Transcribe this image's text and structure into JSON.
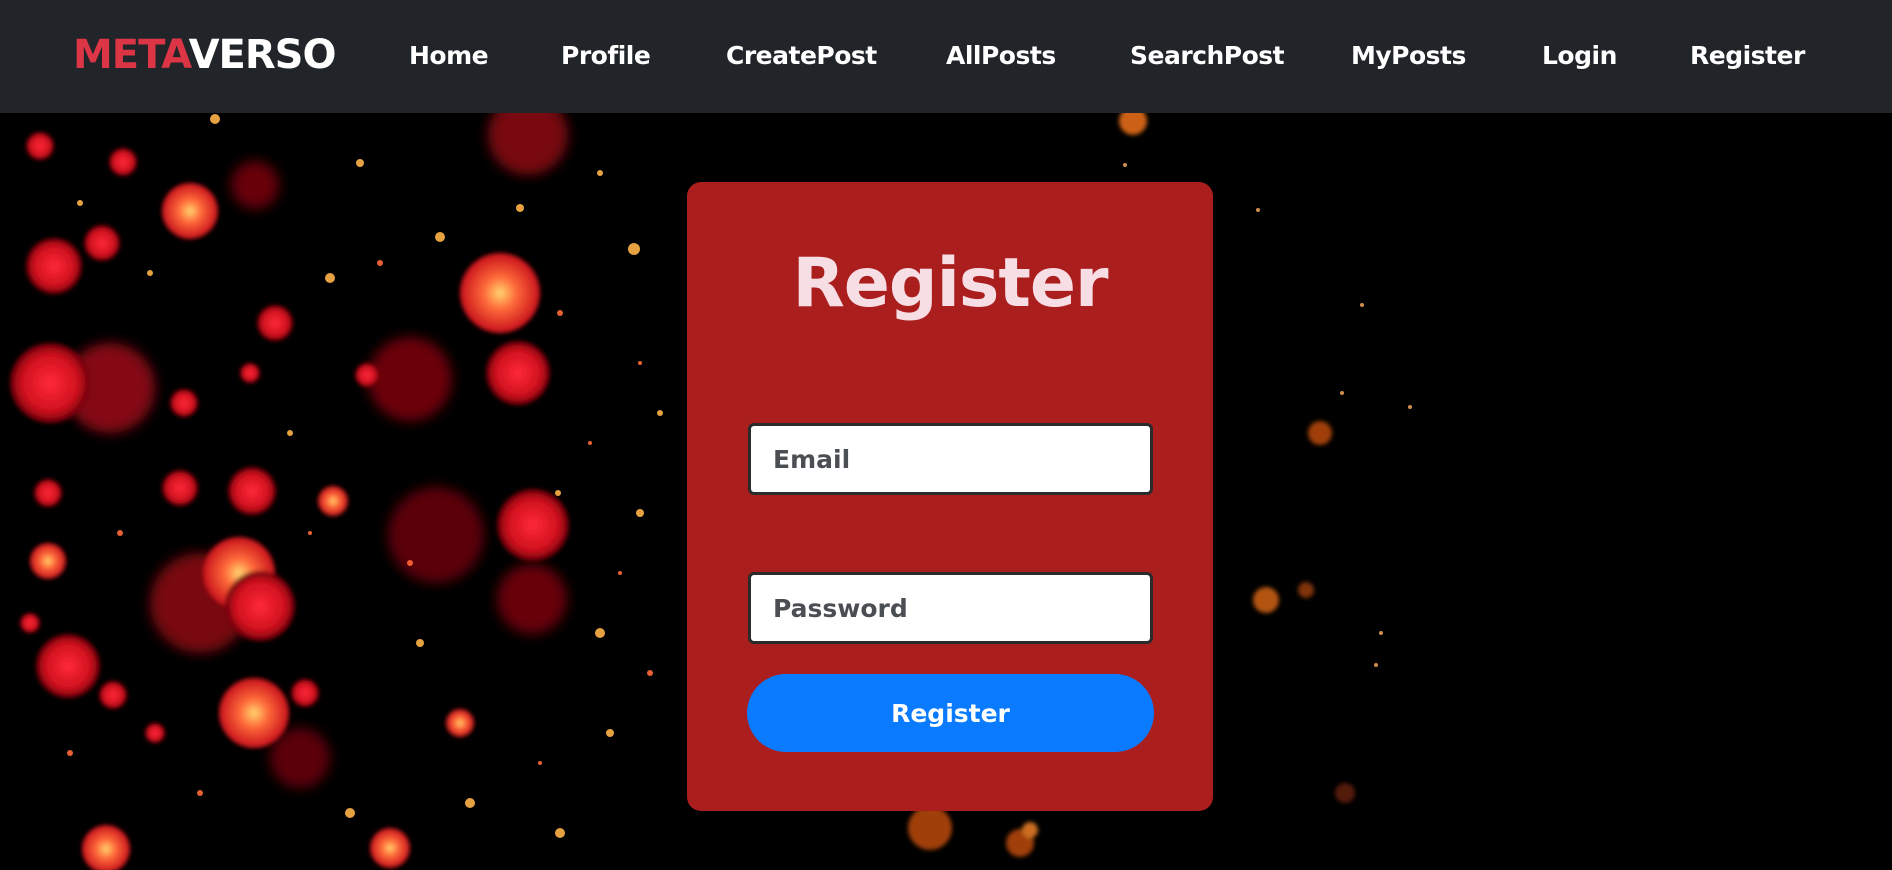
{
  "brand": {
    "part1": "META",
    "part2": "VERSO"
  },
  "nav": {
    "items": [
      {
        "label": "Home"
      },
      {
        "label": "Profile"
      },
      {
        "label": "CreatePost"
      },
      {
        "label": "AllPosts"
      },
      {
        "label": "SearchPost"
      },
      {
        "label": "MyPosts"
      },
      {
        "label": "Login"
      },
      {
        "label": "Register"
      }
    ]
  },
  "form": {
    "title": "Register",
    "email_placeholder": "Email",
    "password_placeholder": "Password",
    "submit_label": "Register"
  },
  "colors": {
    "navbar_bg": "#212529",
    "brand_accent": "#dc3545",
    "card_bg": "#ab1e1e",
    "button_bg": "#0a7bff",
    "title_text": "#f7dde4"
  }
}
